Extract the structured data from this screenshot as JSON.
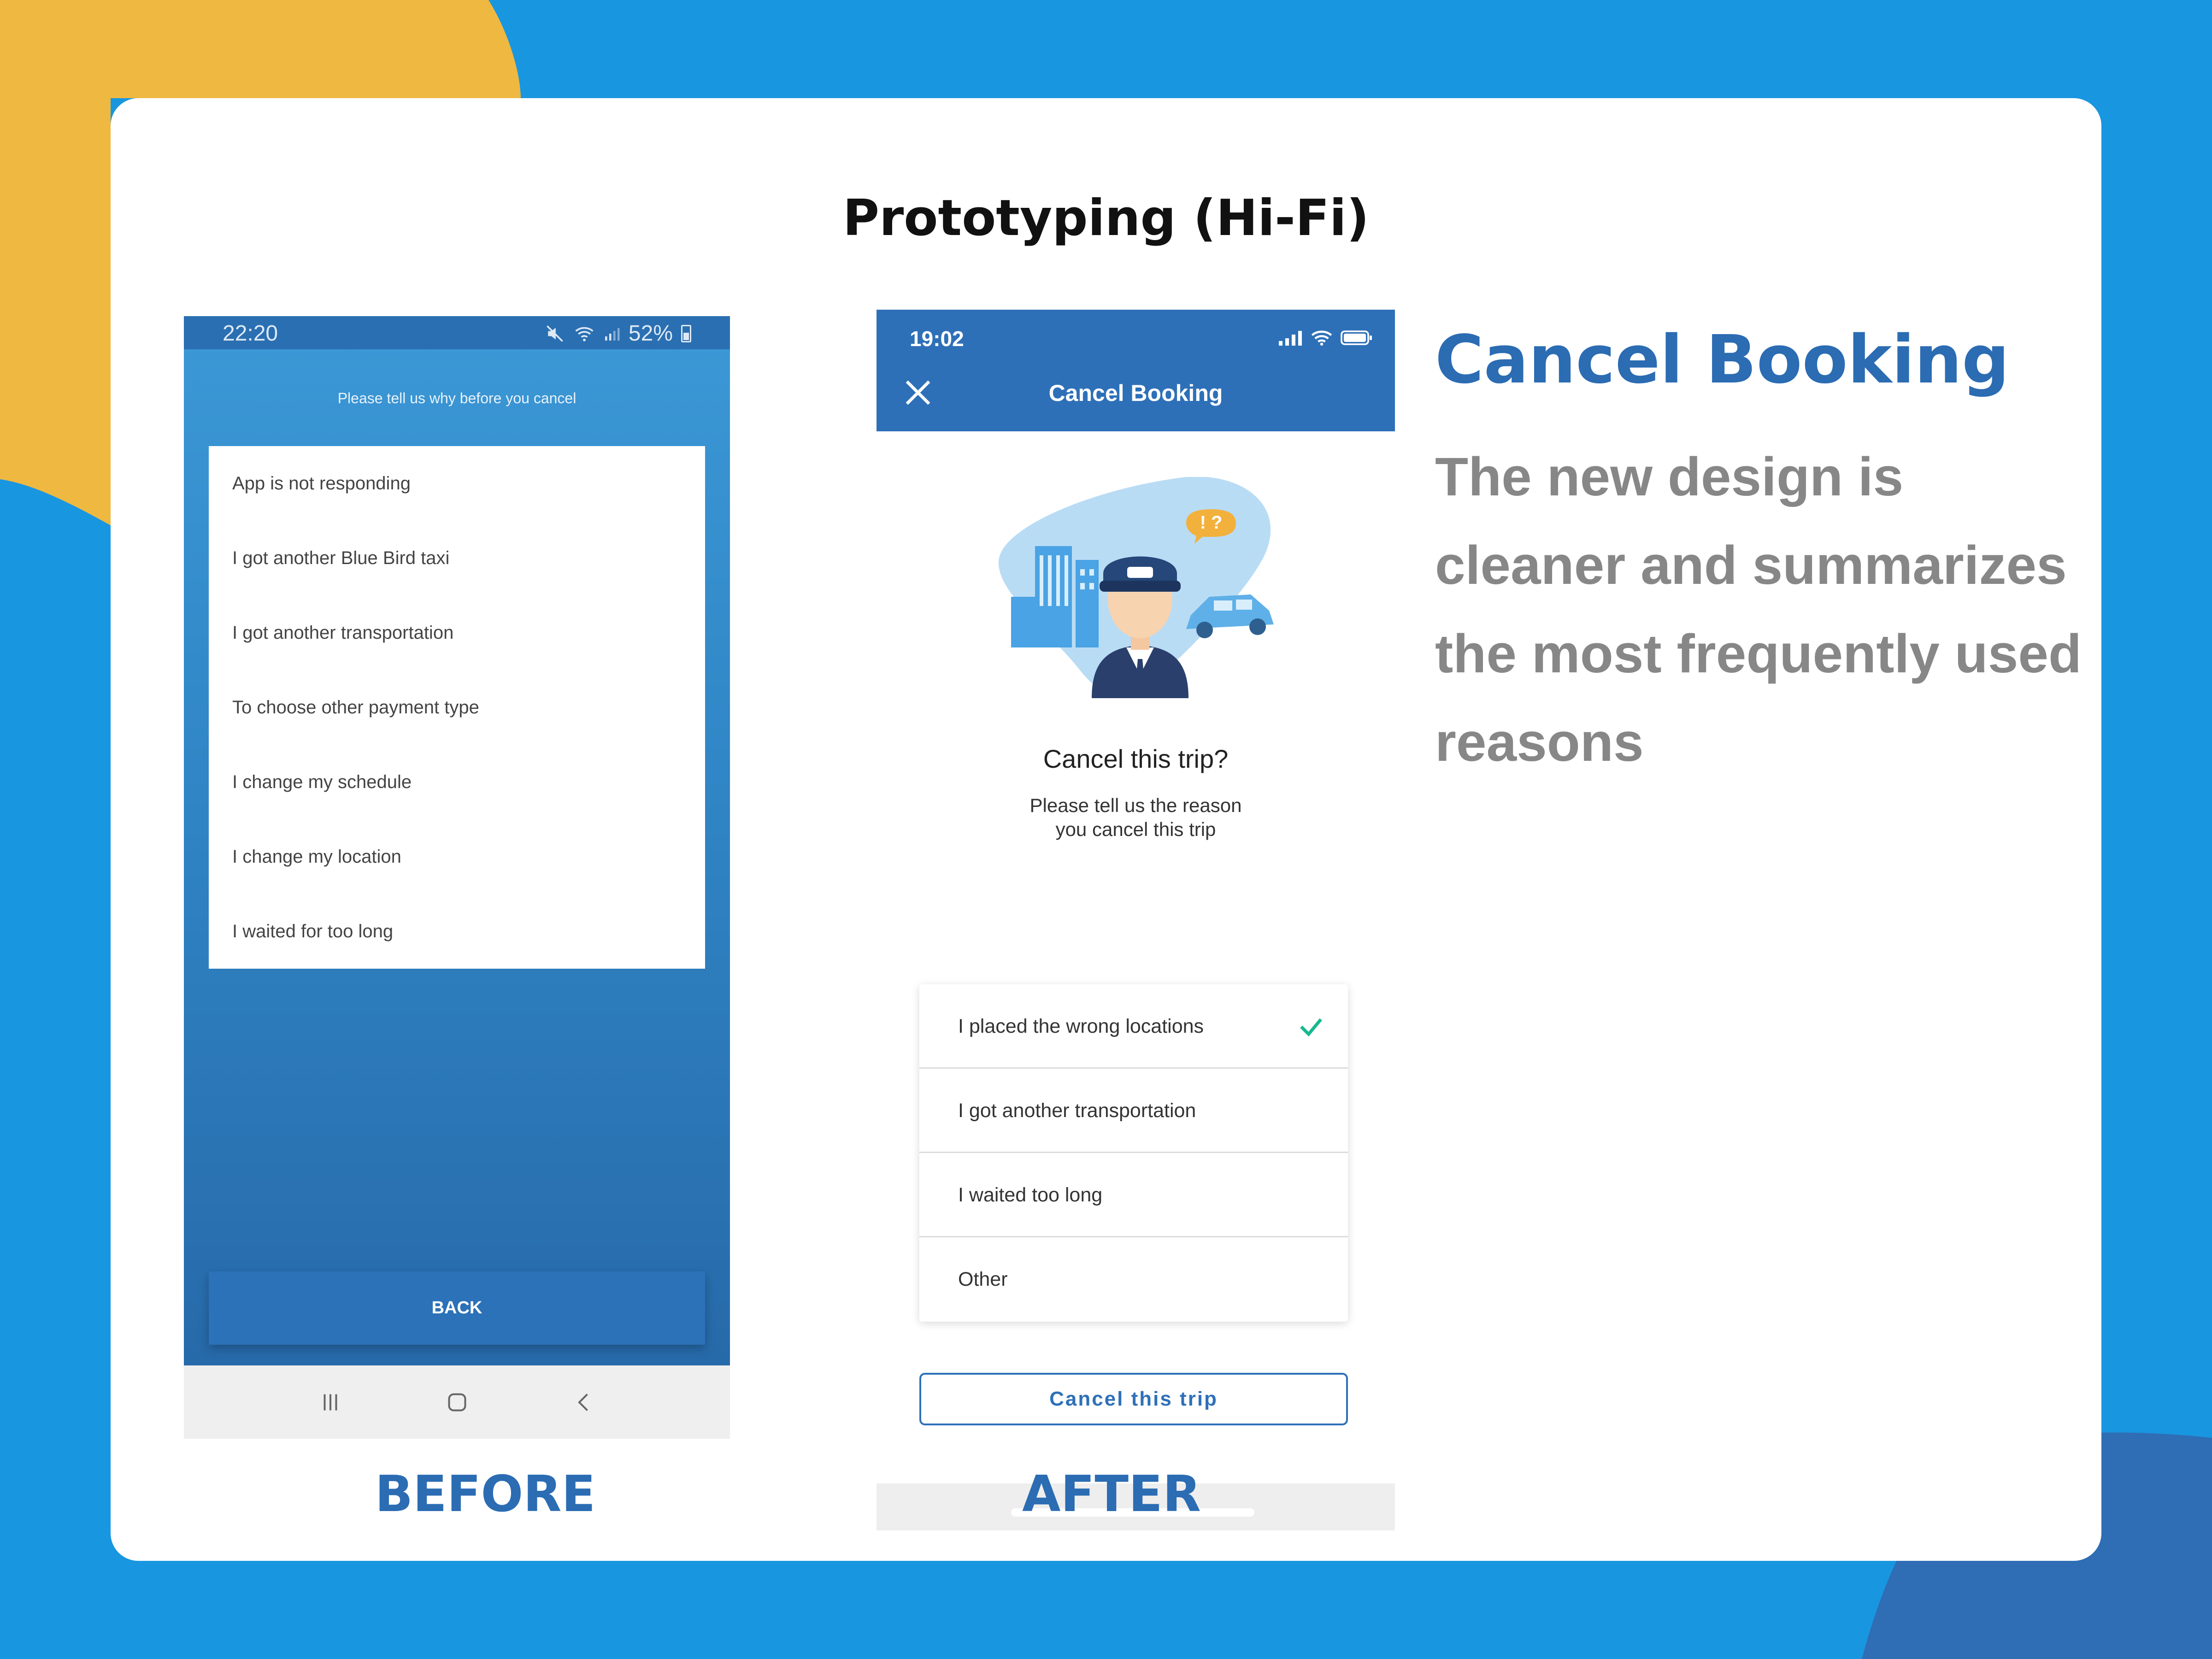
{
  "page": {
    "title": "Prototyping (Hi-Fi)"
  },
  "before": {
    "label": "BEFORE",
    "status": {
      "time": "22:20",
      "battery": "52%"
    },
    "subtitle": "Please tell us why before you cancel",
    "reasons": [
      "App is not responding",
      "I got another Blue Bird taxi",
      "I got another transportation",
      "To choose other payment type",
      "I change my schedule",
      "I change my location",
      "I waited for too long"
    ],
    "back_label": "BACK",
    "nav": {
      "recents_icon": "recents-icon",
      "home_icon": "home-icon",
      "back_icon": "back-arrow-icon"
    }
  },
  "after": {
    "label": "AFTER",
    "status": {
      "time": "19:02"
    },
    "header_title": "Cancel Booking",
    "question": "Cancel this trip?",
    "hint": "Please tell us the reason you cancel this trip",
    "options": [
      {
        "label": "I placed the wrong locations",
        "selected": true
      },
      {
        "label": "I got another transportation",
        "selected": false
      },
      {
        "label": "I waited too long",
        "selected": false
      },
      {
        "label": "Other",
        "selected": false
      }
    ],
    "cancel_button": "Cancel this trip",
    "bubble_text": "! ?"
  },
  "summary": {
    "heading": "Cancel Booking",
    "description": "The new design is cleaner and summarizes the most frequently used reasons"
  },
  "colors": {
    "background": "#1996e0",
    "accent_yellow": "#efb840",
    "brand_blue": "#2b6cb3",
    "check_green": "#17b890",
    "muted_text": "#878787"
  }
}
